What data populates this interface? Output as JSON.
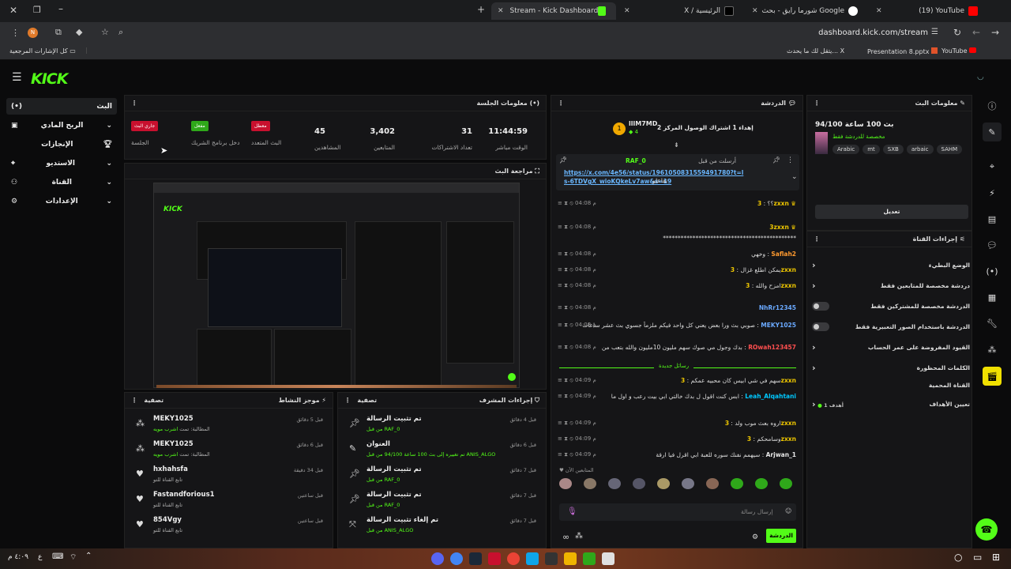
{
  "browser": {
    "tabs": [
      {
        "label": "(19) YouTube"
      },
      {
        "label": "شورما رايق - بحث Google"
      },
      {
        "label": "X / الرئيسية"
      },
      {
        "label": "Stream - Kick Dashboard"
      }
    ],
    "url": "dashboard.kick.com/stream",
    "profile_initial": "N",
    "bookmarks": [
      {
        "label": "YouTube"
      },
      {
        "label": "Presentation 8.pptx"
      },
      {
        "label": "يتقل لك ما يحدث... X"
      },
      {
        "label": "كل الإشارات المرجعية"
      }
    ]
  },
  "app": {
    "logo": "KICK",
    "nav": [
      {
        "label": "البث"
      },
      {
        "label": "الربح المادي"
      },
      {
        "label": "الإنجازات"
      },
      {
        "label": "الاستديو"
      },
      {
        "label": "القناة"
      },
      {
        "label": "الإعدادات"
      }
    ]
  },
  "session": {
    "title": "معلومات الجلسة",
    "stats": [
      {
        "value": "11:44:59",
        "label": "الوقت مباشر"
      },
      {
        "value": "31",
        "label": "تعداد الاشتراكات"
      },
      {
        "value": "3,402",
        "label": "المتابعين"
      },
      {
        "value": "45",
        "label": "المشاهدين"
      }
    ],
    "badges": [
      {
        "text": "معطل",
        "label": "البث المتعدد",
        "color": "#c8102e"
      },
      {
        "text": "مفعل",
        "label": "دخل برنامج الشريك",
        "color": "#2fa81a"
      },
      {
        "text": "جاري البث",
        "label": "الجلسة",
        "color": "#c8102e"
      }
    ]
  },
  "preview": {
    "title": "مراجعة البث"
  },
  "activity": {
    "title": "موجز النشاط",
    "filter": "تصفية",
    "items": [
      {
        "name": "MEKY1025",
        "sub": "المطالبة: تمت",
        "tag": "اشرب مويه",
        "time": "قبل 5 دقائق"
      },
      {
        "name": "MEKY1025",
        "sub": "المطالبة: تمت",
        "tag": "اشرب مويه",
        "time": "قبل 6 دقائق"
      },
      {
        "name": "hxhahsfa",
        "sub": "تابع القناة للتو",
        "tag": "",
        "time": "قبل 34 دقيقة"
      },
      {
        "name": "Fastandforious1",
        "sub": "تابع القناة للتو",
        "tag": "",
        "time": "قبل ساعتين"
      },
      {
        "name": "854Vgy",
        "sub": "تابع القناة للتو",
        "tag": "",
        "time": "قبل ساعتين"
      }
    ]
  },
  "mod": {
    "title": "إجراءات المشرف",
    "filter": "تصفية",
    "items": [
      {
        "title": "تم تثبيت الرسالة",
        "sub": "من قبل RAF_0",
        "time": "قبل 4 دقائق"
      },
      {
        "title": "العنوان",
        "sub": "تم تغييره إلى بث 100 ساعة 94/100 من قبل ANIS_ALGO",
        "time": "قبل 6 دقائق"
      },
      {
        "title": "تم تثبيت الرسالة",
        "sub": "من قبل RAF_0",
        "time": "قبل 7 دقائق"
      },
      {
        "title": "تم تثبيت الرسالة",
        "sub": "من قبل RAF_0",
        "time": "قبل 7 دقائق"
      },
      {
        "title": "تم إلغاء تثبيت الرسالة",
        "sub": "من قبل ANIS_ALGO",
        "time": "قبل 7 دقائق"
      }
    ]
  },
  "chat": {
    "title": "الدردشة",
    "goal_user": "lllM7MD",
    "goal_count": "4",
    "goal_text": "إهداء 1 اشتراك الوصول المركز 2",
    "pinned_by": "RAF_0",
    "pinned_label": "أرسلت من قبل",
    "pinned_link": "https://x.com/4e56/status/1961050831559491780?t=ls-6TDVgX_wioKQkeLv7aw&s=19",
    "pinned_tail": "تفاعلو",
    "new_messages": "رسائل جديدة",
    "messages": [
      {
        "time": "04:08 م",
        "user": "3zxxn",
        "color": "#f0c800",
        "text": "؟؟"
      },
      {
        "time": "04:08 م",
        "user": "3zxxn",
        "color": "#f0c800",
        "text": "*********************************************"
      },
      {
        "time": "04:08 م",
        "user": "Saflah2",
        "color": "#ff9a2f",
        "text": "وخهي"
      },
      {
        "time": "04:08 م",
        "user": "3zxxn",
        "color": "#f0c800",
        "text": "يمكن اطلع غزال"
      },
      {
        "time": "04:08 م",
        "user": "3zxxn",
        "color": "#f0c800",
        "text": "امزح والله"
      },
      {
        "time": "04:08 م",
        "user": "NhRr12345",
        "color": "#6aa9ff",
        "text": ""
      },
      {
        "time": "04:08 م",
        "user": "MEKY1025",
        "color": "#6aa9ff",
        "text": "صوبي بث ورا بعض يعني كل واحد فيكم ملزماً جسوي بث عشر ساعات"
      },
      {
        "time": "04:08 م",
        "user": "ROwah123457",
        "color": "#ff4f4f",
        "text": "بدك وجول مي صوك سهم مليون 10مليون والله بتعب من"
      },
      {
        "time": "04:09 م",
        "user": "3zxxn",
        "color": "#f0c800",
        "text": "سهم في شي ابيس كان محبيه عمكم"
      },
      {
        "time": "04:09 م",
        "user": "Leah_Alqahtani",
        "color": "#00c8ff",
        "text": "ابس كنت اقول ل بدك خالتي ابي بيت رعب و اول ما"
      },
      {
        "time": "04:09 م",
        "user": "3zxxn",
        "color": "#f0c800",
        "text": "اروه بعث موب ولد"
      },
      {
        "time": "04:09 م",
        "user": "3zxxn",
        "color": "#f0c800",
        "text": "وسامحكم"
      },
      {
        "time": "04:09 م",
        "user": "Arjwan_1",
        "color": "#e8e8e8",
        "text": "سيهمم نفنك سوره للعبة ابي اقرل فيا ارقة"
      }
    ],
    "active_users": "المتابعين الآن",
    "input_placeholder": "إرسال رسالة",
    "send_label": "الدردشة"
  },
  "stream_info": {
    "title": "معلومات البث",
    "stream_title": "بث 100 ساعة 94/100",
    "category": "مخصصة للدردشة فقط",
    "tags": [
      "SAHM",
      "arbaic",
      "SXB",
      "mt",
      "Arabic"
    ],
    "edit_label": "تعديل"
  },
  "channel_actions": {
    "title": "إجراءات القناة",
    "rows": [
      {
        "label": "الوضع البطيء",
        "type": "chevron"
      },
      {
        "label": "دردشة مخصصة للمتابعين فقط",
        "type": "chevron"
      },
      {
        "label": "الدردشة مخصصة للمشتركين فقط",
        "type": "toggle"
      },
      {
        "label": "الدردشة باستخدام الصور التعبيرية فقط",
        "type": "toggle"
      },
      {
        "label": "القيود المفروضة على عمر الحساب",
        "type": "chevron"
      },
      {
        "label": "الكلمات المحظورة",
        "type": "chevron"
      },
      {
        "label": "القناة المحمية",
        "type": "none"
      },
      {
        "label": "تعيين الأهداف",
        "type": "goal",
        "extra": "أهدف 1"
      }
    ]
  },
  "taskbar": {
    "time": "٤:٠٩ م",
    "lang": "ع"
  }
}
